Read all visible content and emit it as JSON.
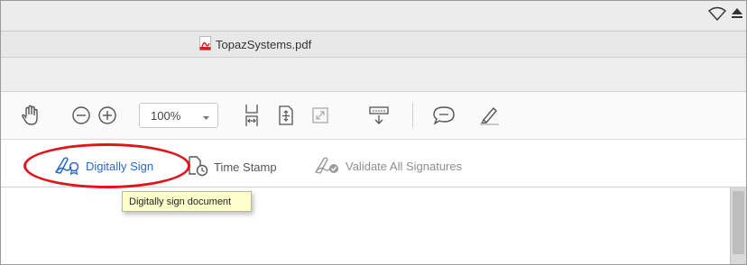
{
  "window": {
    "title": "TopazSystems.pdf",
    "file_icon": "pdf-file-icon"
  },
  "menubar": {
    "icons": [
      "wifi-icon",
      "eject-icon"
    ]
  },
  "toolbar": {
    "zoom_value": "100%",
    "tools": [
      "hand-tool-icon",
      "zoom-out-icon",
      "zoom-in-icon",
      "fit-width-icon",
      "fit-page-icon",
      "full-screen-icon",
      "read-mode-icon",
      "comment-icon",
      "highlight-pen-icon"
    ]
  },
  "signbar": {
    "digitally_sign": "Digitally Sign",
    "time_stamp": "Time Stamp",
    "validate_all": "Validate All Signatures"
  },
  "tooltip": {
    "text": "Digitally sign document"
  },
  "colors": {
    "accent": "#2a6ac9",
    "annotation_oval": "#e0141c",
    "tooltip_bg": "#ffffcc"
  }
}
